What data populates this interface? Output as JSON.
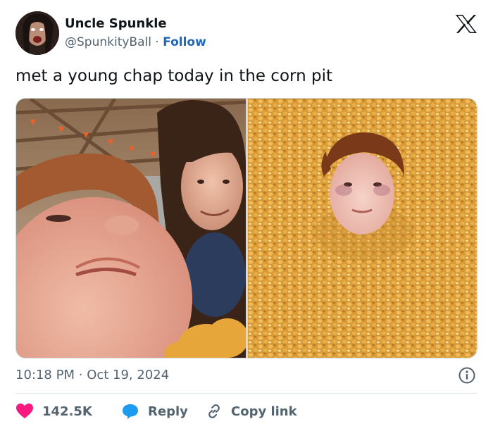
{
  "author": {
    "name": "Uncle Spunkle",
    "handle": "@SpunkityBall",
    "separator": "·",
    "follow_label": "Follow"
  },
  "tweet": {
    "text": "met a young chap today in the corn pit"
  },
  "meta": {
    "time": "10:18 PM",
    "separator": "·",
    "date": "Oct 19, 2024"
  },
  "actions": {
    "like_count": "142.5K",
    "reply_label": "Reply",
    "copy_link_label": "Copy link"
  },
  "icons": {
    "brand": "x-logo-icon",
    "info": "info-icon",
    "like": "heart-icon",
    "reply": "speech-bubble-icon",
    "copy": "link-icon"
  },
  "colors": {
    "follow": "#1d67c0",
    "like": "#f91880",
    "reply": "#1d9bf0",
    "secondary_text": "#536471",
    "border": "#cfd9de"
  }
}
